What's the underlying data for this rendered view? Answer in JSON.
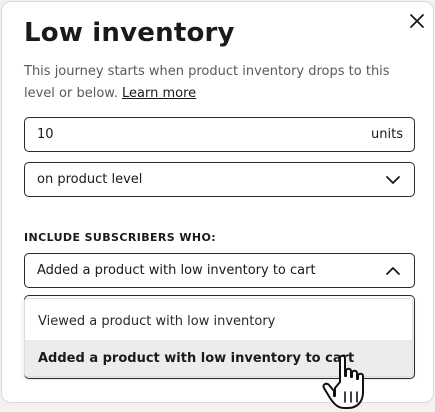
{
  "modal": {
    "title": "Low inventory",
    "description": "This journey starts when product inventory drops to this level or below.",
    "learn_more": "Learn more"
  },
  "threshold": {
    "value": "10",
    "unit": "units"
  },
  "level_select": {
    "selected": "on product level"
  },
  "subscribers": {
    "label": "INCLUDE SUBSCRIBERS WHO:",
    "selected": "Added a product with low inventory to cart",
    "options": [
      {
        "label": "Viewed a product with low inventory",
        "selected": false
      },
      {
        "label": "Added a product with low inventory to cart",
        "selected": true
      }
    ]
  },
  "icons": {
    "close": "close-icon",
    "dropdown": "chevron-down-icon",
    "dropdown_open": "chevron-up-icon",
    "pointer": "hand-pointer-cursor"
  }
}
